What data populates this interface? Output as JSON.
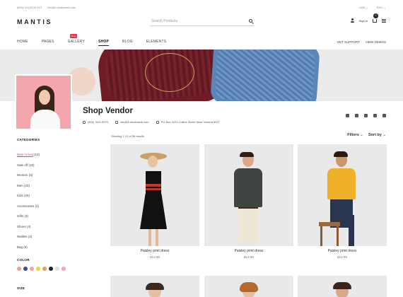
{
  "topbar": {
    "phone": "(800) 116-8139 513",
    "email": "info@it-studioweb.com",
    "currency": "USD",
    "language": "ENG"
  },
  "header": {
    "logo": "MANTIS",
    "search_placeholder": "Search Products",
    "signin": "Sign in",
    "cart_count": "0"
  },
  "nav": {
    "items": [
      "HOME",
      "PAGES",
      "GALLERY",
      "SHOP",
      "BLOG",
      "ELEMENTS"
    ],
    "new_badge": "New",
    "right": [
      "GET SUPPORT",
      "VIEW DEMOS"
    ]
  },
  "vendor": {
    "title": "Shop Vendor",
    "phone": "(800) 3311 5070",
    "email": "info@it-studioweb.com",
    "address": "PO Box 3221 Collins Street West Victoria 8007"
  },
  "results": {
    "showing": "Showing 1 12 of 36 results",
    "filters": "Filters",
    "sort": "Sort by"
  },
  "sidebar": {
    "categories_title": "CATEGORIES",
    "categories": [
      {
        "label": "New Arrival",
        "count": "(10)"
      },
      {
        "label": "Sale off",
        "count": "(15)"
      },
      {
        "label": "Women",
        "count": "(5)"
      },
      {
        "label": "Men",
        "count": "(23)"
      },
      {
        "label": "Kids",
        "count": "(26)"
      },
      {
        "label": "Accessories",
        "count": "(2)"
      },
      {
        "label": "Gifts",
        "count": "(3)"
      },
      {
        "label": "Shoes",
        "count": "(4)"
      },
      {
        "label": "Wallets",
        "count": "(2)"
      },
      {
        "label": "Bag",
        "count": "(5)"
      }
    ],
    "color_title": "COLOR",
    "colors": [
      "#f0a090",
      "#3a4aa0",
      "#f4a4a4",
      "#e8d840",
      "#f09a60",
      "#222222",
      "#e0e0e0",
      "#f4a0d0"
    ],
    "size_title": "SIZE"
  },
  "products": [
    {
      "name": "Paisley print dress",
      "price": "$13.99"
    },
    {
      "name": "Paisley print dress",
      "price": "$13.99"
    },
    {
      "name": "Paisley print dress",
      "price": "$13.99"
    }
  ]
}
